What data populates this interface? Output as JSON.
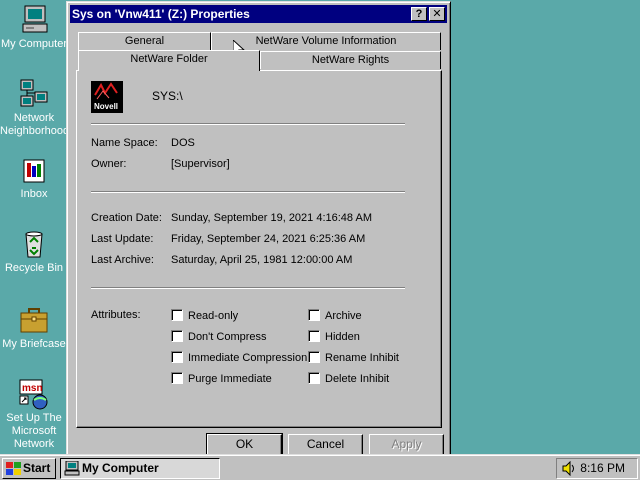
{
  "desktop": {
    "icons": [
      {
        "label": "My Computer",
        "icon": "computer-icon"
      },
      {
        "label": "Network Neighborhood",
        "line1": "Network",
        "line2": "Neighborhood",
        "icon": "network-icon"
      },
      {
        "label": "Inbox",
        "icon": "inbox-icon"
      },
      {
        "label": "Recycle Bin",
        "icon": "recycle-bin-icon"
      },
      {
        "label": "My Briefcase",
        "icon": "briefcase-icon"
      },
      {
        "label": "Set Up The Microsoft Network",
        "line1": "Set Up The",
        "line2": "Microsoft",
        "line3": "Network",
        "icon": "msn-icon"
      }
    ]
  },
  "window": {
    "title": "Sys on 'Vnw411' (Z:) Properties",
    "help_btn": "?",
    "close_btn": "✕",
    "tabs": {
      "general": "General",
      "volume_info": "NetWare Volume Information",
      "folder": "NetWare Folder",
      "rights": "NetWare Rights"
    },
    "active_tab": "NetWare Folder",
    "logo_text": "Novell",
    "path": "SYS:\\",
    "fields": {
      "name_space_label": "Name Space:",
      "name_space_value": "DOS",
      "owner_label": "Owner:",
      "owner_value": "[Supervisor]",
      "creation_date_label": "Creation Date:",
      "creation_date_value": "Sunday, September 19, 2021 4:16:48 AM",
      "last_update_label": "Last Update:",
      "last_update_value": "Friday, September 24, 2021 6:25:36 AM",
      "last_archive_label": "Last Archive:",
      "last_archive_value": "Saturday, April 25, 1981 12:00:00 AM"
    },
    "attributes_label": "Attributes:",
    "attributes": {
      "read_only": {
        "label": "Read-only",
        "checked": false
      },
      "dont_compress": {
        "label": "Don't Compress",
        "checked": false
      },
      "immediate_compression": {
        "label": "Immediate Compression",
        "checked": false
      },
      "purge_immediate": {
        "label": "Purge Immediate",
        "checked": false
      },
      "archive": {
        "label": "Archive",
        "checked": false
      },
      "hidden": {
        "label": "Hidden",
        "checked": false
      },
      "rename_inhibit": {
        "label": "Rename Inhibit",
        "checked": false
      },
      "delete_inhibit": {
        "label": "Delete Inhibit",
        "checked": false
      }
    },
    "buttons": {
      "ok": "OK",
      "cancel": "Cancel",
      "apply": "Apply"
    }
  },
  "taskbar": {
    "start_label": "Start",
    "task_label": "My Computer",
    "clock": "8:16 PM"
  },
  "colors": {
    "desktop": "#5aa9a9",
    "titlebar": "#000080",
    "face": "#c0c0c0"
  }
}
